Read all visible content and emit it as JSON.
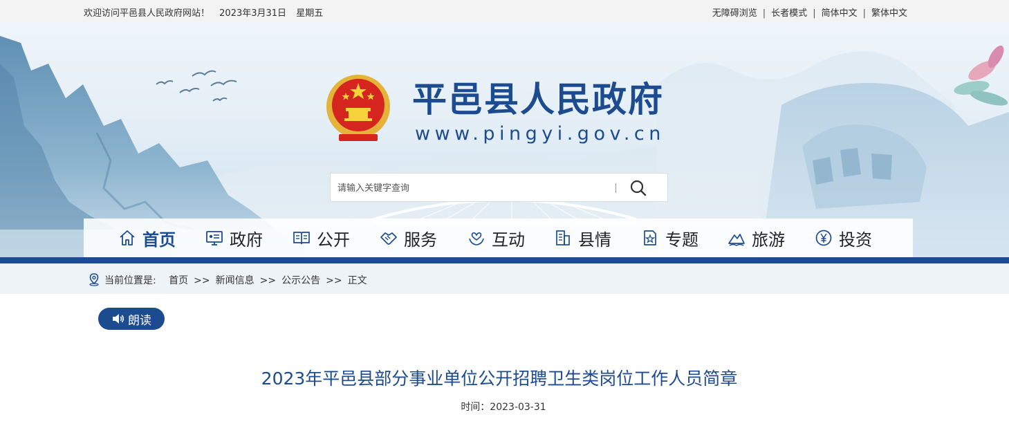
{
  "topbar": {
    "welcome": "欢迎访问平邑县人民政府网站！",
    "date": "2023年3月31日",
    "weekday": "星期五",
    "links": [
      "无障碍浏览",
      "长者模式",
      "简体中文",
      "繁体中文"
    ]
  },
  "header": {
    "site_title": "平邑县人民政府",
    "site_url": "www.pingyi.gov.cn"
  },
  "search": {
    "placeholder": "请输入关键字查询",
    "value": ""
  },
  "nav": {
    "items": [
      {
        "label": "首页",
        "icon": "home-icon",
        "active": true
      },
      {
        "label": "政府",
        "icon": "monitor-icon"
      },
      {
        "label": "公开",
        "icon": "book-icon"
      },
      {
        "label": "服务",
        "icon": "handshake-icon"
      },
      {
        "label": "互动",
        "icon": "heart-hands-icon"
      },
      {
        "label": "县情",
        "icon": "building-icon"
      },
      {
        "label": "专题",
        "icon": "star-doc-icon"
      },
      {
        "label": "旅游",
        "icon": "mountain-icon"
      },
      {
        "label": "投资",
        "icon": "yuan-icon"
      }
    ]
  },
  "breadcrumb": {
    "lead": "当前位置是:",
    "items": [
      "首页",
      "新闻信息",
      "公示公告",
      "正文"
    ],
    "separator": ">>"
  },
  "article": {
    "read_label": "朗读",
    "title": "2023年平邑县部分事业单位公开招聘卫生类岗位工作人员简章",
    "time": "时间：2023-03-31"
  },
  "colors": {
    "brand": "#1d4b8f",
    "topbar_bg": "#f3f3f3",
    "crumb_bg": "#eef3f8"
  }
}
